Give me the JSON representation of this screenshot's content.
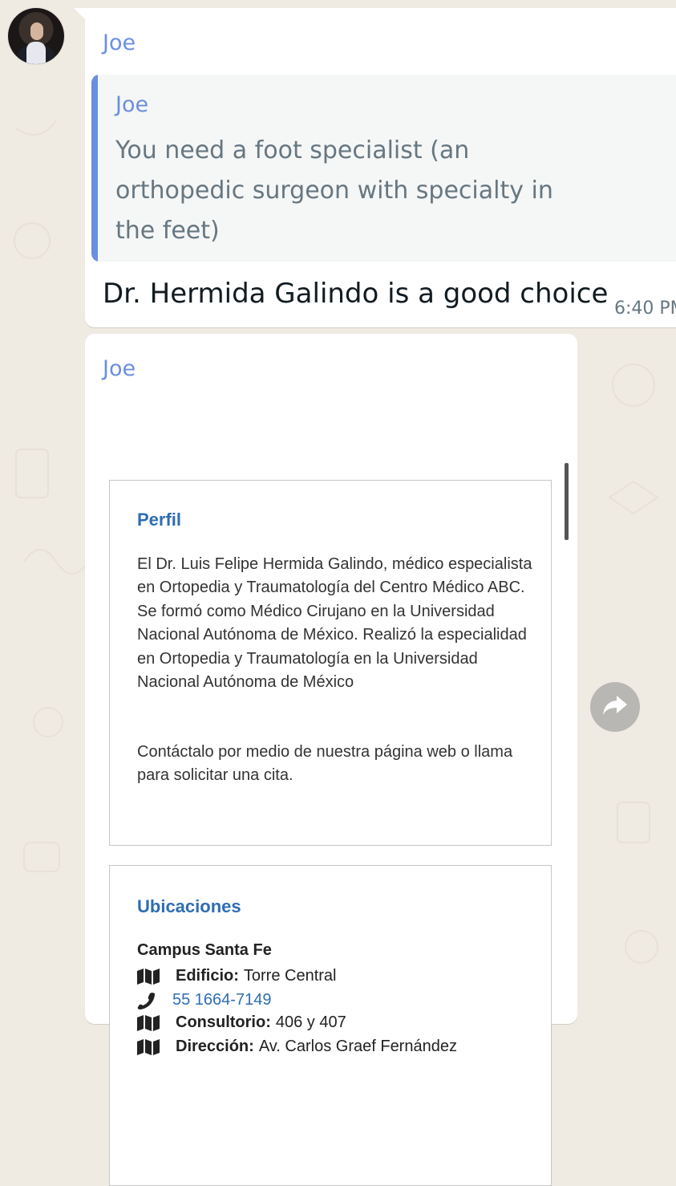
{
  "chat": {
    "message1": {
      "sender": "Joe",
      "quoted": {
        "sender": "Joe",
        "text": "You need a foot specialist (an orthopedic surgeon with specialty in the feet)"
      },
      "text": "Dr. Hermida Galindo is a good choice",
      "time": "6:40 PM"
    },
    "message2": {
      "sender": "Joe",
      "screenshot": {
        "perfil": {
          "heading": "Perfil",
          "paragraph1": "El Dr. Luis Felipe Hermida Galindo, médico especialista en Ortopedia y Traumatología del Centro Médico ABC. Se formó como Médico Cirujano en la Universidad Nacional Autónoma de México. Realizó la especialidad en Ortopedia y Traumatología en la Universidad Nacional Autónoma de México",
          "paragraph2": "Contáctalo por medio de nuestra página web o llama para solicitar una cita."
        },
        "ubicaciones": {
          "heading": "Ubicaciones",
          "campus": "Campus Santa Fe",
          "edificio_label": "Edificio:",
          "edificio_value": "Torre Central",
          "phone": "55 1664-7149",
          "consultorio_label": "Consultorio:",
          "consultorio_value": "406 y 407",
          "direccion_label": "Dirección:",
          "direccion_value": "Av. Carlos Graef Fernández"
        }
      }
    }
  },
  "icons": {
    "map": "map-icon",
    "phone": "phone-icon",
    "forward": "forward-icon"
  }
}
